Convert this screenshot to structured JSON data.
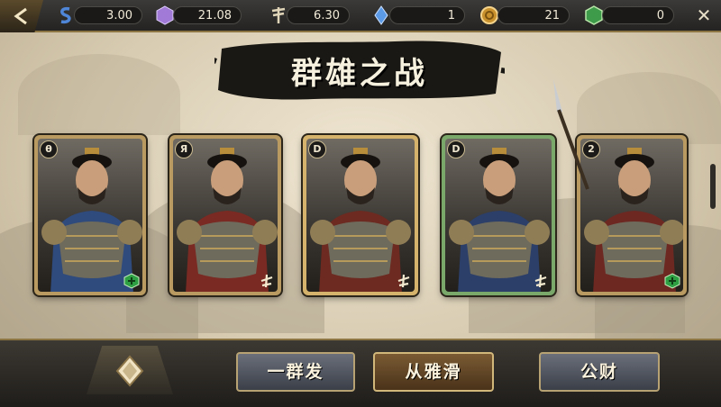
{
  "resources": [
    {
      "name": "s-icon",
      "value": "3.00",
      "color": "#4f86d8"
    },
    {
      "name": "gem-icon",
      "value": "21.08",
      "color": "#a07ad6"
    },
    {
      "name": "spear-icon",
      "value": "6.30",
      "color": "#e0d5b8"
    },
    {
      "name": "crystal-icon",
      "value": "1",
      "color": "#5b9ae6"
    },
    {
      "name": "coin-icon",
      "value": "21",
      "color": "#c9912e"
    },
    {
      "name": "jade-icon",
      "value": "0",
      "color": "#3d9b4a"
    }
  ],
  "banner": {
    "title": "群雄之战"
  },
  "cards": [
    {
      "rank": "θ",
      "frame": "#b99b61",
      "robe": "#2f4a7c",
      "badge": "green-cube-icon",
      "badge_color": "#2ea043"
    },
    {
      "rank": "Я",
      "frame": "#b99b61",
      "robe": "#7a2a22",
      "badge": "mark-icon",
      "badge_color": "#f3ead0"
    },
    {
      "rank": "D",
      "frame": "#d6b36c",
      "robe": "#6c2a20",
      "badge": "mark-icon",
      "badge_color": "#f3ead0"
    },
    {
      "rank": "D",
      "frame": "#7aa86a",
      "robe": "#2b3f68",
      "badge": "mark-icon",
      "badge_color": "#f3ead0"
    },
    {
      "rank": "2",
      "frame": "#b99b61",
      "robe": "#6e2822",
      "badge": "green-cube-icon",
      "badge_color": "#2ea043"
    }
  ],
  "buttons": {
    "first": "一群发",
    "second": "从雅滑",
    "third": "公财"
  },
  "close_label": "✕"
}
